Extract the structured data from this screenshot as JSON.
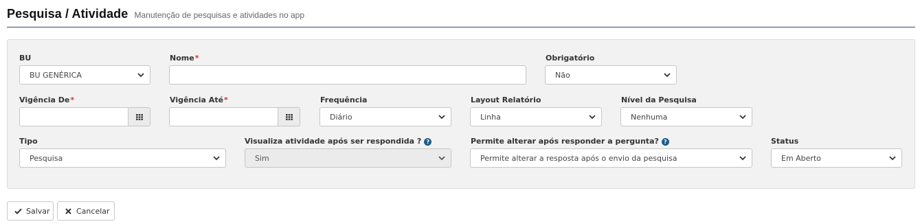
{
  "header": {
    "title": "Pesquisa / Atividade",
    "subtitle": "Manutenção de pesquisas e atividades no app"
  },
  "form": {
    "bu": {
      "label": "BU",
      "value": "BU GENÉRICA"
    },
    "nome": {
      "label": "Nome",
      "required_mark": "*",
      "value": ""
    },
    "obrigatorio": {
      "label": "Obrigatório",
      "value": "Não"
    },
    "vigencia_de": {
      "label": "Vigência De",
      "required_mark": "*",
      "value": ""
    },
    "vigencia_ate": {
      "label": "Vigência Até",
      "required_mark": "*",
      "value": ""
    },
    "frequencia": {
      "label": "Frequência",
      "value": "Diário"
    },
    "layout_relatorio": {
      "label": "Layout Relatório",
      "value": "Linha"
    },
    "nivel_pesquisa": {
      "label": "Nível da Pesquisa",
      "value": "Nenhuma"
    },
    "tipo": {
      "label": "Tipo",
      "value": "Pesquisa"
    },
    "visualiza": {
      "label": "Visualiza atividade após ser respondida ?",
      "value": "Sim",
      "disabled": true
    },
    "permite_alterar": {
      "label": "Permite alterar após responder a pergunta?",
      "value": "Permite alterar a resposta após o envio da pesquisa"
    },
    "status": {
      "label": "Status",
      "value": "Em Aberto"
    }
  },
  "actions": {
    "save_label": "Salvar",
    "cancel_label": "Cancelar"
  },
  "colors": {
    "required": "#d9322c",
    "header_rule": "#2a4f6e",
    "help_icon": "#1b5e89",
    "panel_bg": "#f2f2f2"
  },
  "icons": {
    "select_arrow": "chevron-down-icon",
    "date_picker": "calendar-grid-icon",
    "help": "question-circle-icon",
    "save": "check-icon",
    "cancel": "close-icon"
  }
}
